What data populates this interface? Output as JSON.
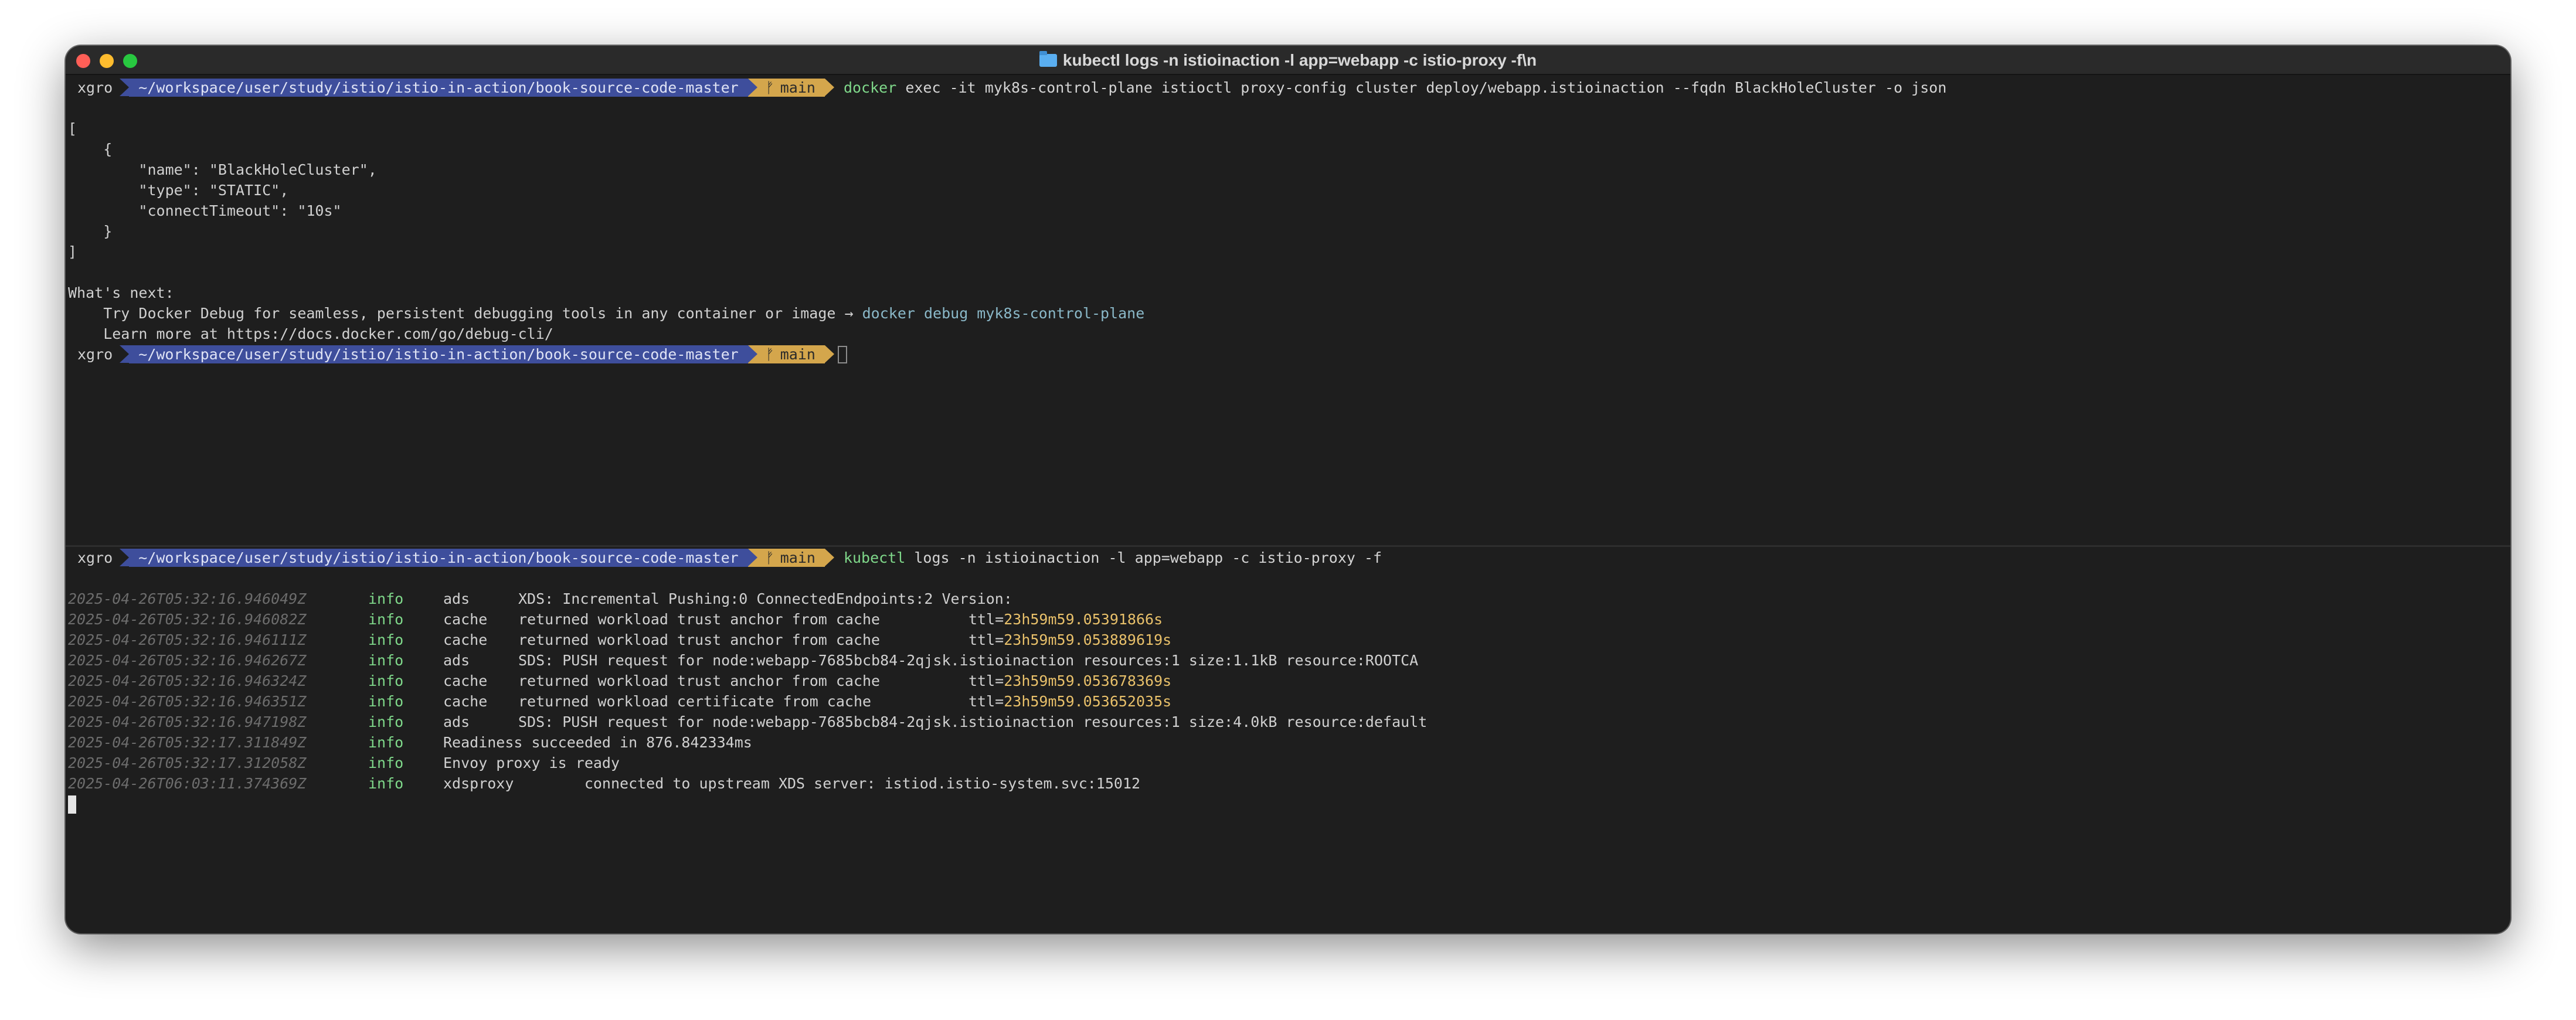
{
  "window": {
    "title": "kubectl logs -n istioinaction -l app=webapp -c istio-proxy -f\\n",
    "title_icon": "folder-icon"
  },
  "colors": {
    "terminal_bg": "#1e1e1e",
    "path_segment": "#3e4e9c",
    "branch_segment": "#d4a64c",
    "info": "#7fd88a",
    "ttl": "#e8c06a"
  },
  "prompt": {
    "user": "xgro",
    "path": "~/workspace/user/study/istio/istio-in-action/book-source-code-master",
    "branch_icon": "ᚠ",
    "branch": "main"
  },
  "top_pane": {
    "command_name": "docker",
    "command_args": "exec -it myk8s-control-plane istioctl proxy-config cluster deploy/webapp.istioinaction --fqdn BlackHoleCluster -o json",
    "output": [
      "[",
      "    {",
      "        \"name\": \"BlackHoleCluster\",",
      "        \"type\": \"STATIC\",",
      "        \"connectTimeout\": \"10s\"",
      "    }",
      "]"
    ],
    "whats_next": "What's next:",
    "hint_prefix": "    Try Docker Debug for seamless, persistent debugging tools in any container or image → ",
    "hint_command": "docker debug myk8s-control-plane",
    "learn_more": "    Learn more at https://docs.docker.com/go/debug-cli/"
  },
  "bottom_pane": {
    "command_name": "kubectl",
    "command_args": "logs -n istioinaction -l app=webapp -c istio-proxy -f",
    "logs": [
      {
        "ts": "2025-04-26T05:32:16.946049Z",
        "level": "info",
        "scope": "ads",
        "msg": "XDS: Incremental Pushing:0 ConnectedEndpoints:2 Version:",
        "ttl": ""
      },
      {
        "ts": "2025-04-26T05:32:16.946082Z",
        "level": "info",
        "scope": "cache",
        "msg": "returned workload trust anchor from cache",
        "ttl": "23h59m59.05391866s"
      },
      {
        "ts": "2025-04-26T05:32:16.946111Z",
        "level": "info",
        "scope": "cache",
        "msg": "returned workload trust anchor from cache",
        "ttl": "23h59m59.053889619s"
      },
      {
        "ts": "2025-04-26T05:32:16.946267Z",
        "level": "info",
        "scope": "ads",
        "msg": "SDS: PUSH request for node:webapp-7685bcb84-2qjsk.istioinaction resources:1 size:1.1kB resource:ROOTCA",
        "ttl": ""
      },
      {
        "ts": "2025-04-26T05:32:16.946324Z",
        "level": "info",
        "scope": "cache",
        "msg": "returned workload trust anchor from cache",
        "ttl": "23h59m59.053678369s"
      },
      {
        "ts": "2025-04-26T05:32:16.946351Z",
        "level": "info",
        "scope": "cache",
        "msg": "returned workload certificate from cache",
        "ttl": "23h59m59.053652035s"
      },
      {
        "ts": "2025-04-26T05:32:16.947198Z",
        "level": "info",
        "scope": "ads",
        "msg": "SDS: PUSH request for node:webapp-7685bcb84-2qjsk.istioinaction resources:1 size:4.0kB resource:default",
        "ttl": ""
      },
      {
        "ts": "2025-04-26T05:32:17.311849Z",
        "level": "info",
        "scope": "",
        "msg": "Readiness succeeded in 876.842334ms",
        "ttl": ""
      },
      {
        "ts": "2025-04-26T05:32:17.312058Z",
        "level": "info",
        "scope": "",
        "msg": "Envoy proxy is ready",
        "ttl": ""
      },
      {
        "ts": "2025-04-26T06:03:11.374369Z",
        "level": "info",
        "scope": "",
        "msg": "xdsproxy        connected to upstream XDS server: istiod.istio-system.svc:15012",
        "ttl": ""
      }
    ]
  }
}
